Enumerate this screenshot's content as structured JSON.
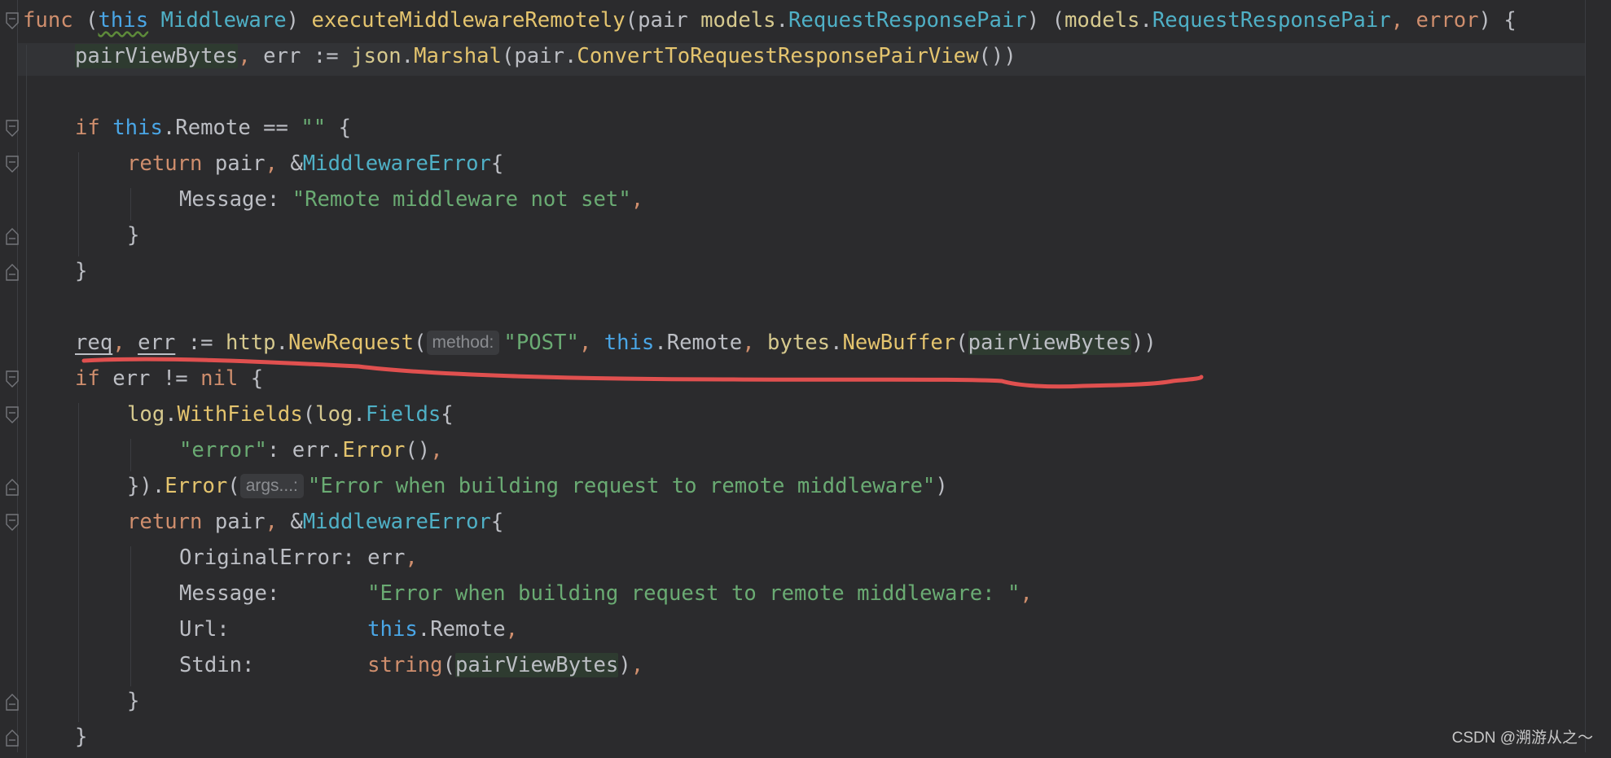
{
  "editor": {
    "lines": [
      {
        "indent": 0,
        "tokens": [
          {
            "t": "func",
            "c": "kw"
          },
          {
            "t": " (",
            "c": "plain"
          },
          {
            "t": "this",
            "c": "recv wavy"
          },
          {
            "t": " ",
            "c": "plain"
          },
          {
            "t": "Middleware",
            "c": "type"
          },
          {
            "t": ") ",
            "c": "plain"
          },
          {
            "t": "executeMiddlewareRemotely",
            "c": "fn"
          },
          {
            "t": "(pair ",
            "c": "plain"
          },
          {
            "t": "models",
            "c": "pkg"
          },
          {
            "t": ".",
            "c": "plain"
          },
          {
            "t": "RequestResponsePair",
            "c": "type"
          },
          {
            "t": ") (",
            "c": "plain"
          },
          {
            "t": "models",
            "c": "pkg"
          },
          {
            "t": ".",
            "c": "plain"
          },
          {
            "t": "RequestResponsePair",
            "c": "type"
          },
          {
            "t": ", ",
            "c": "punc"
          },
          {
            "t": "error",
            "c": "kw"
          },
          {
            "t": ") {",
            "c": "plain"
          }
        ]
      },
      {
        "indent": 1,
        "tokens": [
          {
            "t": "pairViewBytes",
            "c": "plain hl"
          },
          {
            "t": ", ",
            "c": "punc"
          },
          {
            "t": "err := ",
            "c": "plain"
          },
          {
            "t": "json",
            "c": "pkg"
          },
          {
            "t": ".",
            "c": "plain"
          },
          {
            "t": "Marshal",
            "c": "fn"
          },
          {
            "t": "(pair.",
            "c": "plain"
          },
          {
            "t": "ConvertToRequestResponsePairView",
            "c": "fn"
          },
          {
            "t": "())",
            "c": "plain"
          }
        ]
      },
      {
        "indent": 0,
        "tokens": []
      },
      {
        "indent": 1,
        "tokens": [
          {
            "t": "if ",
            "c": "kw"
          },
          {
            "t": "this",
            "c": "recv"
          },
          {
            "t": ".Remote == ",
            "c": "plain"
          },
          {
            "t": "\"\"",
            "c": "str"
          },
          {
            "t": " {",
            "c": "plain"
          }
        ]
      },
      {
        "indent": 2,
        "tokens": [
          {
            "t": "return ",
            "c": "kw"
          },
          {
            "t": "pair",
            "c": "plain"
          },
          {
            "t": ", ",
            "c": "punc"
          },
          {
            "t": "&",
            "c": "plain"
          },
          {
            "t": "MiddlewareError",
            "c": "type"
          },
          {
            "t": "{",
            "c": "plain"
          }
        ]
      },
      {
        "indent": 3,
        "tokens": [
          {
            "t": "Message: ",
            "c": "plain"
          },
          {
            "t": "\"Remote middleware not set\"",
            "c": "str"
          },
          {
            "t": ",",
            "c": "punc"
          }
        ]
      },
      {
        "indent": 2,
        "tokens": [
          {
            "t": "}",
            "c": "plain"
          }
        ]
      },
      {
        "indent": 1,
        "tokens": [
          {
            "t": "}",
            "c": "plain"
          }
        ]
      },
      {
        "indent": 0,
        "tokens": []
      },
      {
        "indent": 1,
        "tokens": [
          {
            "t": "req",
            "c": "plain ul"
          },
          {
            "t": ", ",
            "c": "punc"
          },
          {
            "t": "err",
            "c": "plain ul"
          },
          {
            "t": " := ",
            "c": "plain"
          },
          {
            "t": "http",
            "c": "pkg"
          },
          {
            "t": ".",
            "c": "plain"
          },
          {
            "t": "NewRequest",
            "c": "fn"
          },
          {
            "t": "(",
            "c": "plain"
          },
          {
            "hint": "method:"
          },
          {
            "t": "\"POST\"",
            "c": "str"
          },
          {
            "t": ", ",
            "c": "punc"
          },
          {
            "t": "this",
            "c": "recv"
          },
          {
            "t": ".Remote",
            "c": "plain"
          },
          {
            "t": ", ",
            "c": "punc"
          },
          {
            "t": "bytes",
            "c": "pkg"
          },
          {
            "t": ".",
            "c": "plain"
          },
          {
            "t": "NewBuffer",
            "c": "fn"
          },
          {
            "t": "(",
            "c": "plain"
          },
          {
            "t": "pairViewBytes",
            "c": "plain hl"
          },
          {
            "t": "))",
            "c": "plain"
          }
        ]
      },
      {
        "indent": 1,
        "tokens": [
          {
            "t": "if ",
            "c": "kw"
          },
          {
            "t": "err != ",
            "c": "plain"
          },
          {
            "t": "nil",
            "c": "kw"
          },
          {
            "t": " {",
            "c": "plain"
          }
        ]
      },
      {
        "indent": 2,
        "tokens": [
          {
            "t": "log",
            "c": "pkg"
          },
          {
            "t": ".",
            "c": "plain"
          },
          {
            "t": "WithFields",
            "c": "fn"
          },
          {
            "t": "(",
            "c": "plain"
          },
          {
            "t": "log",
            "c": "pkg"
          },
          {
            "t": ".",
            "c": "plain"
          },
          {
            "t": "Fields",
            "c": "type"
          },
          {
            "t": "{",
            "c": "plain"
          }
        ]
      },
      {
        "indent": 3,
        "tokens": [
          {
            "t": "\"error\"",
            "c": "str"
          },
          {
            "t": ": err.",
            "c": "plain"
          },
          {
            "t": "Error",
            "c": "fn"
          },
          {
            "t": "()",
            "c": "plain"
          },
          {
            "t": ",",
            "c": "punc"
          }
        ]
      },
      {
        "indent": 2,
        "tokens": [
          {
            "t": "}).",
            "c": "plain"
          },
          {
            "t": "Error",
            "c": "fn"
          },
          {
            "t": "(",
            "c": "plain"
          },
          {
            "hint": "args...:"
          },
          {
            "t": "\"Error when building request to remote middleware\"",
            "c": "str"
          },
          {
            "t": ")",
            "c": "plain"
          }
        ]
      },
      {
        "indent": 2,
        "tokens": [
          {
            "t": "return ",
            "c": "kw"
          },
          {
            "t": "pair",
            "c": "plain"
          },
          {
            "t": ", ",
            "c": "punc"
          },
          {
            "t": "&",
            "c": "plain"
          },
          {
            "t": "MiddlewareError",
            "c": "type"
          },
          {
            "t": "{",
            "c": "plain"
          }
        ]
      },
      {
        "indent": 3,
        "tokens": [
          {
            "t": "OriginalError: err",
            "c": "plain"
          },
          {
            "t": ",",
            "c": "punc"
          }
        ]
      },
      {
        "indent": 3,
        "tokens": [
          {
            "t": "Message:       ",
            "c": "plain"
          },
          {
            "t": "\"Error when building request to remote middleware: \"",
            "c": "str"
          },
          {
            "t": ",",
            "c": "punc"
          }
        ]
      },
      {
        "indent": 3,
        "tokens": [
          {
            "t": "Url:           ",
            "c": "plain"
          },
          {
            "t": "this",
            "c": "recv"
          },
          {
            "t": ".Remote",
            "c": "plain"
          },
          {
            "t": ",",
            "c": "punc"
          }
        ]
      },
      {
        "indent": 3,
        "tokens": [
          {
            "t": "Stdin:         ",
            "c": "plain"
          },
          {
            "t": "string",
            "c": "kw"
          },
          {
            "t": "(",
            "c": "plain"
          },
          {
            "t": "pairViewBytes",
            "c": "plain hl"
          },
          {
            "t": ")",
            "c": "plain"
          },
          {
            "t": ",",
            "c": "punc"
          }
        ]
      },
      {
        "indent": 2,
        "tokens": [
          {
            "t": "}",
            "c": "plain"
          }
        ]
      },
      {
        "indent": 1,
        "tokens": [
          {
            "t": "}",
            "c": "plain"
          }
        ]
      }
    ]
  },
  "watermark": "CSDN @溯游从之～",
  "colors": {
    "background": "#2b2b2d",
    "keyword": "#cf8e6d",
    "type": "#4fb0c6",
    "function": "#e4c46e",
    "string": "#6aab73",
    "annotation_stroke": "#e0504f"
  }
}
